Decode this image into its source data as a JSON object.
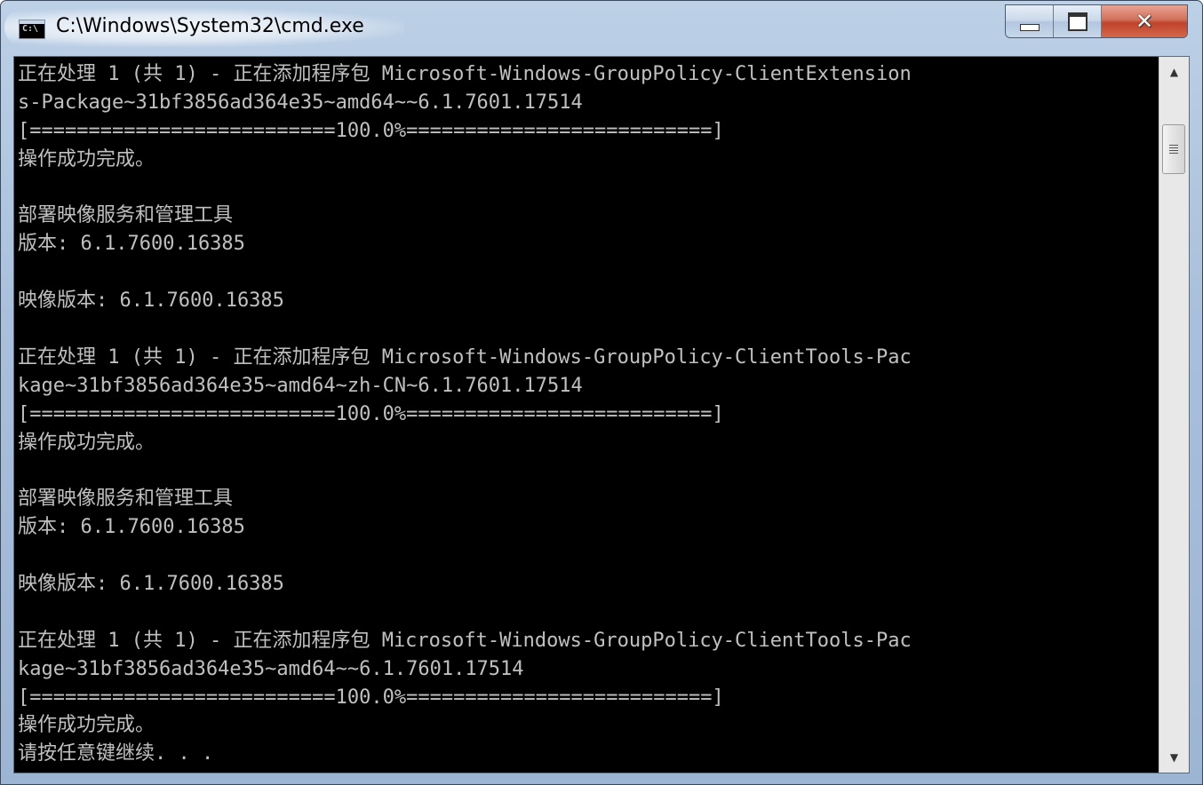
{
  "window": {
    "title": "C:\\Windows\\System32\\cmd.exe",
    "icon_text": "C:\\",
    "close_glyph": "✕"
  },
  "console": {
    "lines": [
      "正在处理 1 (共 1) - 正在添加程序包 Microsoft-Windows-GroupPolicy-ClientExtension",
      "s-Package~31bf3856ad364e35~amd64~~6.1.7601.17514",
      "[==========================100.0%==========================]",
      "操作成功完成。",
      "",
      "部署映像服务和管理工具",
      "版本: 6.1.7600.16385",
      "",
      "映像版本: 6.1.7600.16385",
      "",
      "正在处理 1 (共 1) - 正在添加程序包 Microsoft-Windows-GroupPolicy-ClientTools-Pac",
      "kage~31bf3856ad364e35~amd64~zh-CN~6.1.7601.17514",
      "[==========================100.0%==========================]",
      "操作成功完成。",
      "",
      "部署映像服务和管理工具",
      "版本: 6.1.7600.16385",
      "",
      "映像版本: 6.1.7600.16385",
      "",
      "正在处理 1 (共 1) - 正在添加程序包 Microsoft-Windows-GroupPolicy-ClientTools-Pac",
      "kage~31bf3856ad364e35~amd64~~6.1.7601.17514",
      "[==========================100.0%==========================]",
      "操作成功完成。",
      "请按任意键继续. . ."
    ]
  },
  "scrollbar": {
    "up_glyph": "▲",
    "down_glyph": "▼"
  },
  "colors": {
    "console_bg": "#000000",
    "console_fg": "#c0c0c0",
    "close_button": "#c7452d"
  }
}
